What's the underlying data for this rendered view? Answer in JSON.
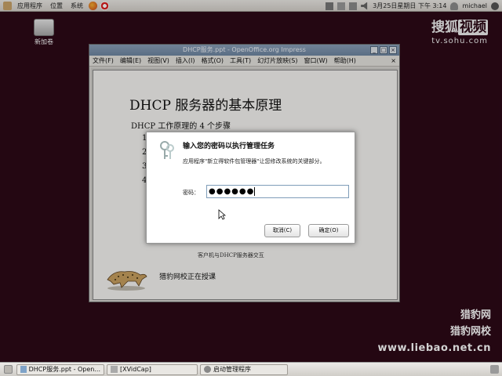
{
  "top_panel": {
    "menus": [
      "应用程序",
      "位置",
      "系统"
    ],
    "datetime": "3月25日星期日 下午 3:14",
    "user": "michael"
  },
  "desktop": {
    "icon_label": "新加卷"
  },
  "watermark": {
    "sohu_left": "搜狐",
    "sohu_box": "视频",
    "sohu_url": "tv.sohu.com",
    "liebao_1": "猎豹网",
    "liebao_2": "猎豹网校",
    "liebao_3": "www.liebao.net.cn"
  },
  "impress": {
    "title": "DHCP服务.ppt - OpenOffice.org Impress",
    "menus": [
      "文件(F)",
      "编辑(E)",
      "视图(V)",
      "插入(I)",
      "格式(O)",
      "工具(T)",
      "幻灯片放映(S)",
      "窗口(W)",
      "帮助(H)"
    ],
    "slide": {
      "title": "DHCP 服务器的基本原理",
      "subtitle": "DHCP 工作原理的 4 个步骤",
      "steps": [
        "1",
        "2",
        "3",
        "4"
      ],
      "caption": "客户机与DHCP服务器交互",
      "footer": "猎豹网校正在授课"
    }
  },
  "dialog": {
    "title": "输入您的密码以执行管理任务",
    "message": "应用程序\"新立得软件包管理器\"让您修改系统的关键部分。",
    "password_label": "密码：",
    "password_value": "●●●●●●",
    "cancel": "取消(C)",
    "ok": "确定(O)"
  },
  "taskbar": {
    "items": [
      "DHCP服务.ppt - Open...",
      "[XVidCap]",
      "启动管理程序"
    ]
  }
}
